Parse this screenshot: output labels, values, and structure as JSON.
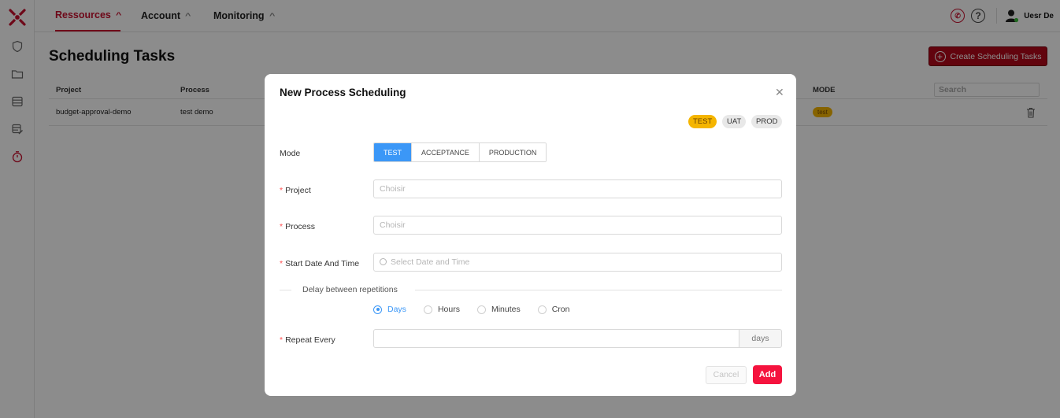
{
  "nav": {
    "items": [
      {
        "label": "Ressources"
      },
      {
        "label": "Account"
      },
      {
        "label": "Monitoring"
      }
    ],
    "user_name": "Uesr De"
  },
  "sidebar": {
    "icons": [
      "shield-icon",
      "folder-icon",
      "database-icon",
      "database-edit-icon",
      "stopwatch-icon"
    ]
  },
  "page": {
    "title": "Scheduling Tasks",
    "create_button": "Create Scheduling Tasks"
  },
  "table": {
    "columns": {
      "project": "Project",
      "process": "Process",
      "mode": "MODE"
    },
    "search_placeholder": "Search",
    "rows": [
      {
        "project": "budget-approval-demo",
        "process": "test demo",
        "mode": "test"
      }
    ]
  },
  "modal": {
    "title": "New Process Scheduling",
    "env_tags": [
      "TEST",
      "UAT",
      "PROD"
    ],
    "mode_label": "Mode",
    "mode_options": [
      "TEST",
      "ACCEPTANCE",
      "PRODUCTION"
    ],
    "mode_selected": "TEST",
    "project_label": "Project",
    "project_placeholder": "Choisir",
    "process_label": "Process",
    "process_placeholder": "Choisir",
    "start_label": "Start Date And Time",
    "start_placeholder": "Select Date and Time",
    "divider_text": "Delay between repetitions",
    "repeat_options": [
      "Days",
      "Hours",
      "Minutes",
      "Cron"
    ],
    "repeat_selected": "Days",
    "repeat_label": "Repeat Every",
    "repeat_value": "",
    "repeat_unit": "days",
    "cancel_label": "Cancel",
    "add_label": "Add"
  },
  "colors": {
    "brand_red": "#c8102e",
    "create_button": "#b3091a",
    "add_button": "#f5133e",
    "active_mode": "#3b97f7",
    "test_tag": "#f5b500"
  }
}
